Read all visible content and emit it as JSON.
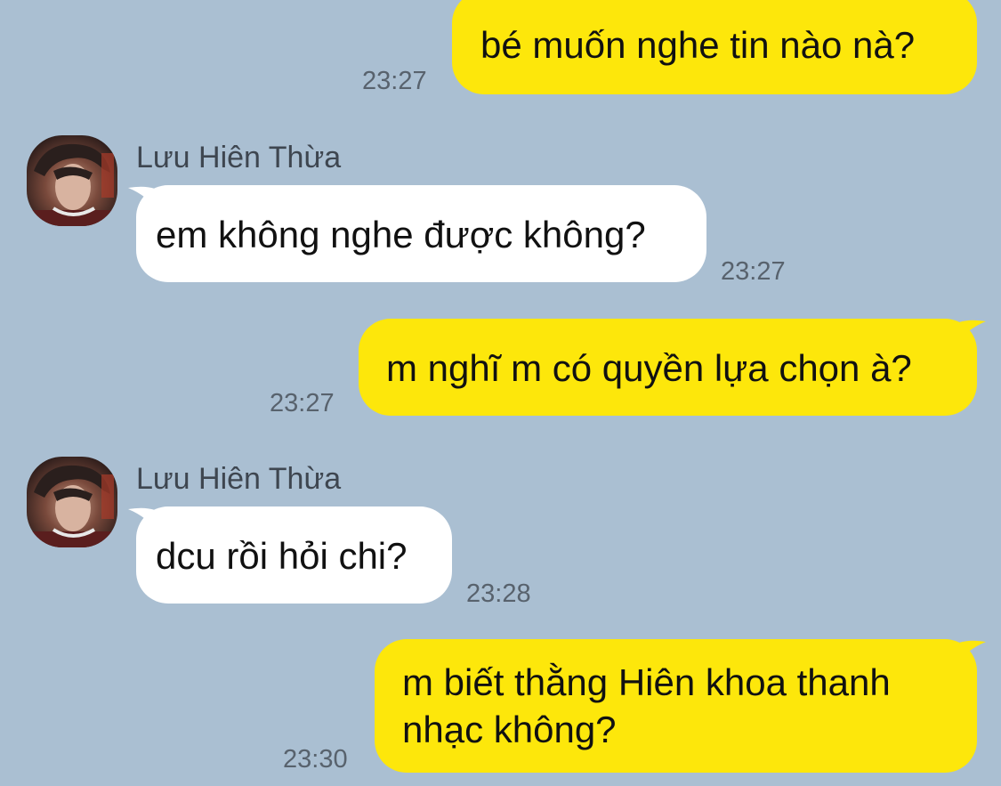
{
  "colors": {
    "background": "#AABFD2",
    "outgoing_bubble": "#FDE70B",
    "incoming_bubble": "#FFFFFF",
    "timestamp": "#58626D"
  },
  "messages": [
    {
      "direction": "outgoing",
      "text": "bé muốn nghe tin nào nà?",
      "time": "23:27"
    },
    {
      "direction": "incoming",
      "sender": "Lưu Hiên Thừa",
      "avatar_icon": "contact-avatar-icon",
      "text": "em không nghe được không?",
      "time": "23:27"
    },
    {
      "direction": "outgoing",
      "text": "m nghĩ m có quyền lựa chọn à?",
      "time": "23:27"
    },
    {
      "direction": "incoming",
      "sender": "Lưu Hiên Thừa",
      "avatar_icon": "contact-avatar-icon",
      "text": "dcu rồi hỏi chi?",
      "time": "23:28"
    },
    {
      "direction": "outgoing",
      "text_line1": "m biết thằng Hiên khoa thanh",
      "text_line2": "nhạc không?",
      "time": "23:30"
    }
  ]
}
